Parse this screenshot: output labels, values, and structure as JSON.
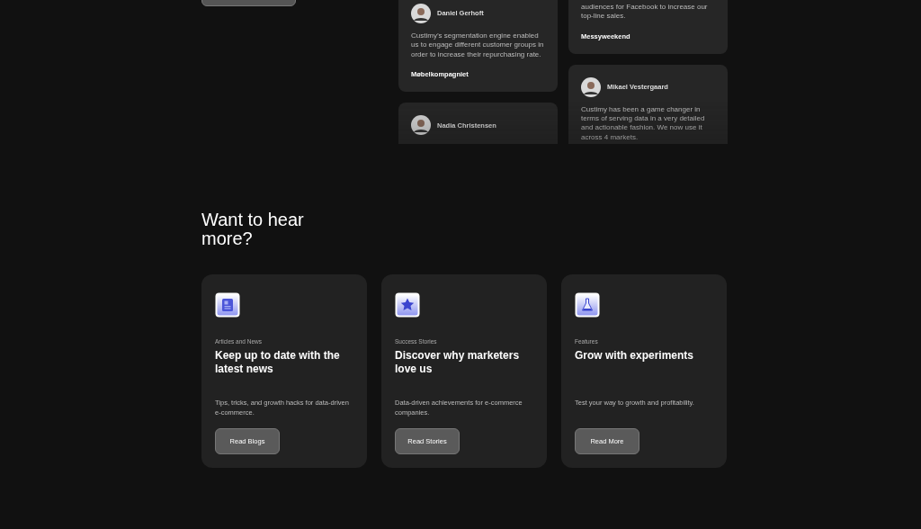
{
  "testimonials": {
    "columns": [
      {
        "cards": [
          {
            "name": "Daniel Gerhoft",
            "quote": "Custimy’s segmentation engine enabled us to engage different customer groups in order to increase their repurchasing rate.",
            "company": "Møbelkompagniet"
          },
          {
            "name": "Nadia Christensen"
          }
        ]
      },
      {
        "cards": [
          {
            "quote": "audiences for Facebook to increase our top-line sales.",
            "company": "Messyweekend"
          },
          {
            "name": "Mikael Vestergaard",
            "quote": "Custimy has been a game changer in terms of serving data in a very detailed and actionable fashion. We now use it across 4 markets."
          }
        ]
      }
    ]
  },
  "more": {
    "heading": "Want to hear more?",
    "cards": [
      {
        "kind": "news",
        "category": "Articles and News",
        "title": "Keep up to date with the latest news",
        "description": "Tips, tricks, and growth hacks for data-driven e-commerce.",
        "button": "Read Blogs"
      },
      {
        "kind": "star",
        "category": "Success Stories",
        "title": "Discover why marketers love us",
        "description": "Data-driven achievements for e-commerce companies.",
        "button": "Read Stories"
      },
      {
        "kind": "flask",
        "category": "Features",
        "title": "Grow with experiments",
        "description": "Test your way to growth and profitability.",
        "button": "Read More"
      }
    ]
  }
}
